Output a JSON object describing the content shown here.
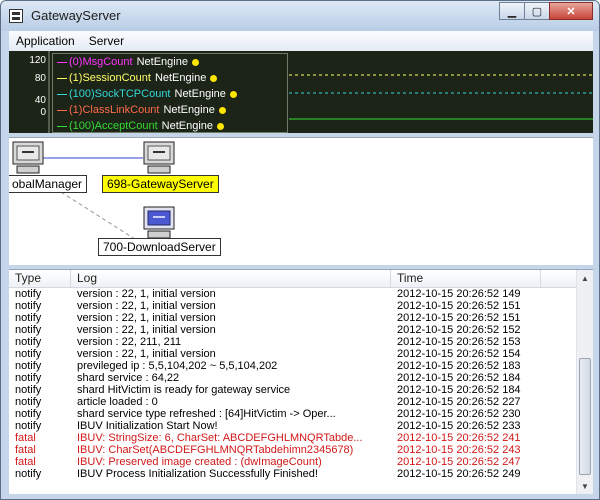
{
  "window": {
    "title": "GatewayServer",
    "minimize_glyph": "▁",
    "maximize_glyph": "▢",
    "close_glyph": "✕"
  },
  "menu": {
    "items": [
      "Application",
      "Server"
    ]
  },
  "chart_data": {
    "type": "line",
    "yticks": [
      "120",
      "80",
      "40",
      "0"
    ],
    "legend_placement": "top-left",
    "series": [
      {
        "name": "(0)MsgCount",
        "source": "NetEngine",
        "color": "#ff33ff"
      },
      {
        "name": "(1)SessionCount",
        "source": "NetEngine",
        "color": "#ffff66"
      },
      {
        "name": "(100)SockTCPCount",
        "source": "NetEngine",
        "color": "#33d6d6"
      },
      {
        "name": "(1)ClassLinkCount",
        "source": "NetEngine",
        "color": "#ff6a4a"
      },
      {
        "name": "(100)AcceptCount",
        "source": "NetEngine",
        "color": "#33dd33"
      }
    ]
  },
  "diagram": {
    "nodes": [
      {
        "label": "obalManager",
        "selected": false
      },
      {
        "label": "698-GatewayServer",
        "selected": true
      },
      {
        "label": "700-DownloadServer",
        "selected": false
      }
    ]
  },
  "log_table": {
    "headers": [
      "Type",
      "Log",
      "Time"
    ],
    "rows": [
      {
        "type": "notify",
        "log": "version : 22, 1, initial version",
        "time": "2012-10-15 20:26:52 149"
      },
      {
        "type": "notify",
        "log": "version : 22, 1, initial version",
        "time": "2012-10-15 20:26:52 151"
      },
      {
        "type": "notify",
        "log": "version : 22, 1, initial version",
        "time": "2012-10-15 20:26:52 151"
      },
      {
        "type": "notify",
        "log": "version : 22, 1, initial version",
        "time": "2012-10-15 20:26:52 152"
      },
      {
        "type": "notify",
        "log": "version : 22, 211, 211",
        "time": "2012-10-15 20:26:52 153"
      },
      {
        "type": "notify",
        "log": "version : 22, 1, initial version",
        "time": "2012-10-15 20:26:52 154"
      },
      {
        "type": "notify",
        "log": "previleged ip : 5,5,104,202 ~ 5,5,104,202",
        "time": "2012-10-15 20:26:52 183"
      },
      {
        "type": "notify",
        "log": "shard service : 64,22",
        "time": "2012-10-15 20:26:52 184"
      },
      {
        "type": "notify",
        "log": "shard HitVictim is ready for gateway service",
        "time": "2012-10-15 20:26:52 184"
      },
      {
        "type": "notify",
        "log": "article loaded : 0",
        "time": "2012-10-15 20:26:52 227"
      },
      {
        "type": "notify",
        "log": "shard service type refreshed : [64]HitVictim -> Oper...",
        "time": "2012-10-15 20:26:52 230"
      },
      {
        "type": "notify",
        "log": "IBUV Initialization Start Now!",
        "time": "2012-10-15 20:26:52 233"
      },
      {
        "type": "fatal",
        "log": "IBUV: StringSize: 6, CharSet: ABCDEFGHLMNQRTabde...",
        "time": "2012-10-15 20:26:52 241"
      },
      {
        "type": "fatal",
        "log": "IBUV: CharSet(ABCDEFGHLMNQRTabdehimn2345678)",
        "time": "2012-10-15 20:26:52 243"
      },
      {
        "type": "fatal",
        "log": "IBUV: Preserved image created : (dwImageCount)",
        "time": "2012-10-15 20:26:52 247"
      },
      {
        "type": "notify",
        "log": "IBUV Process Initialization Successfully Finished!",
        "time": "2012-10-15 20:26:52 249"
      }
    ]
  },
  "icons": {
    "app": "app-window-icon",
    "server": "server-computer-icon",
    "scroll_up": "scroll-up-arrow-icon",
    "scroll_down": "scroll-down-arrow-icon"
  },
  "colors": {
    "chart_bg": "#1c2418",
    "selected_node": "#ffff00",
    "fatal_text": "#d21818",
    "legend_dot": "#ffe600"
  }
}
